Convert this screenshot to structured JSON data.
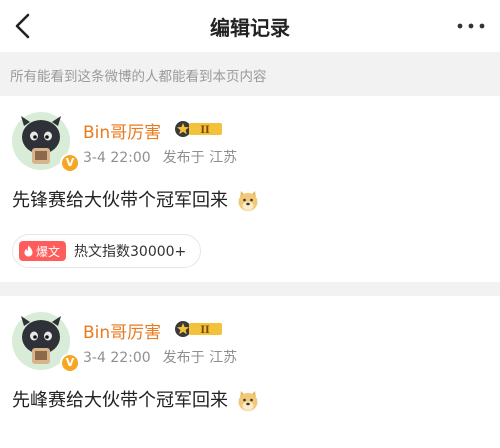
{
  "header": {
    "title": "编辑记录",
    "back_icon": "back-chevron-icon",
    "more_icon": "more-dots-icon"
  },
  "notice": "所有能看到这条微博的人都能看到本页内容",
  "records": [
    {
      "user": "Bin哥厉害",
      "level": "II",
      "time": "3-4 22:00",
      "location": "发布于 江苏",
      "text": "先锋赛给大伙带个冠军回来",
      "hot": {
        "tag": "爆文",
        "label": "热文指数30000+"
      }
    },
    {
      "user": "Bin哥厉害",
      "level": "II",
      "time": "3-4 22:00",
      "location": "发布于 江苏",
      "text": "先峰赛给大伙带个冠军回来"
    }
  ],
  "colors": {
    "username": "#ea7a1e",
    "hot_tag": "#ff5c5c",
    "verified": "#f5a623"
  }
}
